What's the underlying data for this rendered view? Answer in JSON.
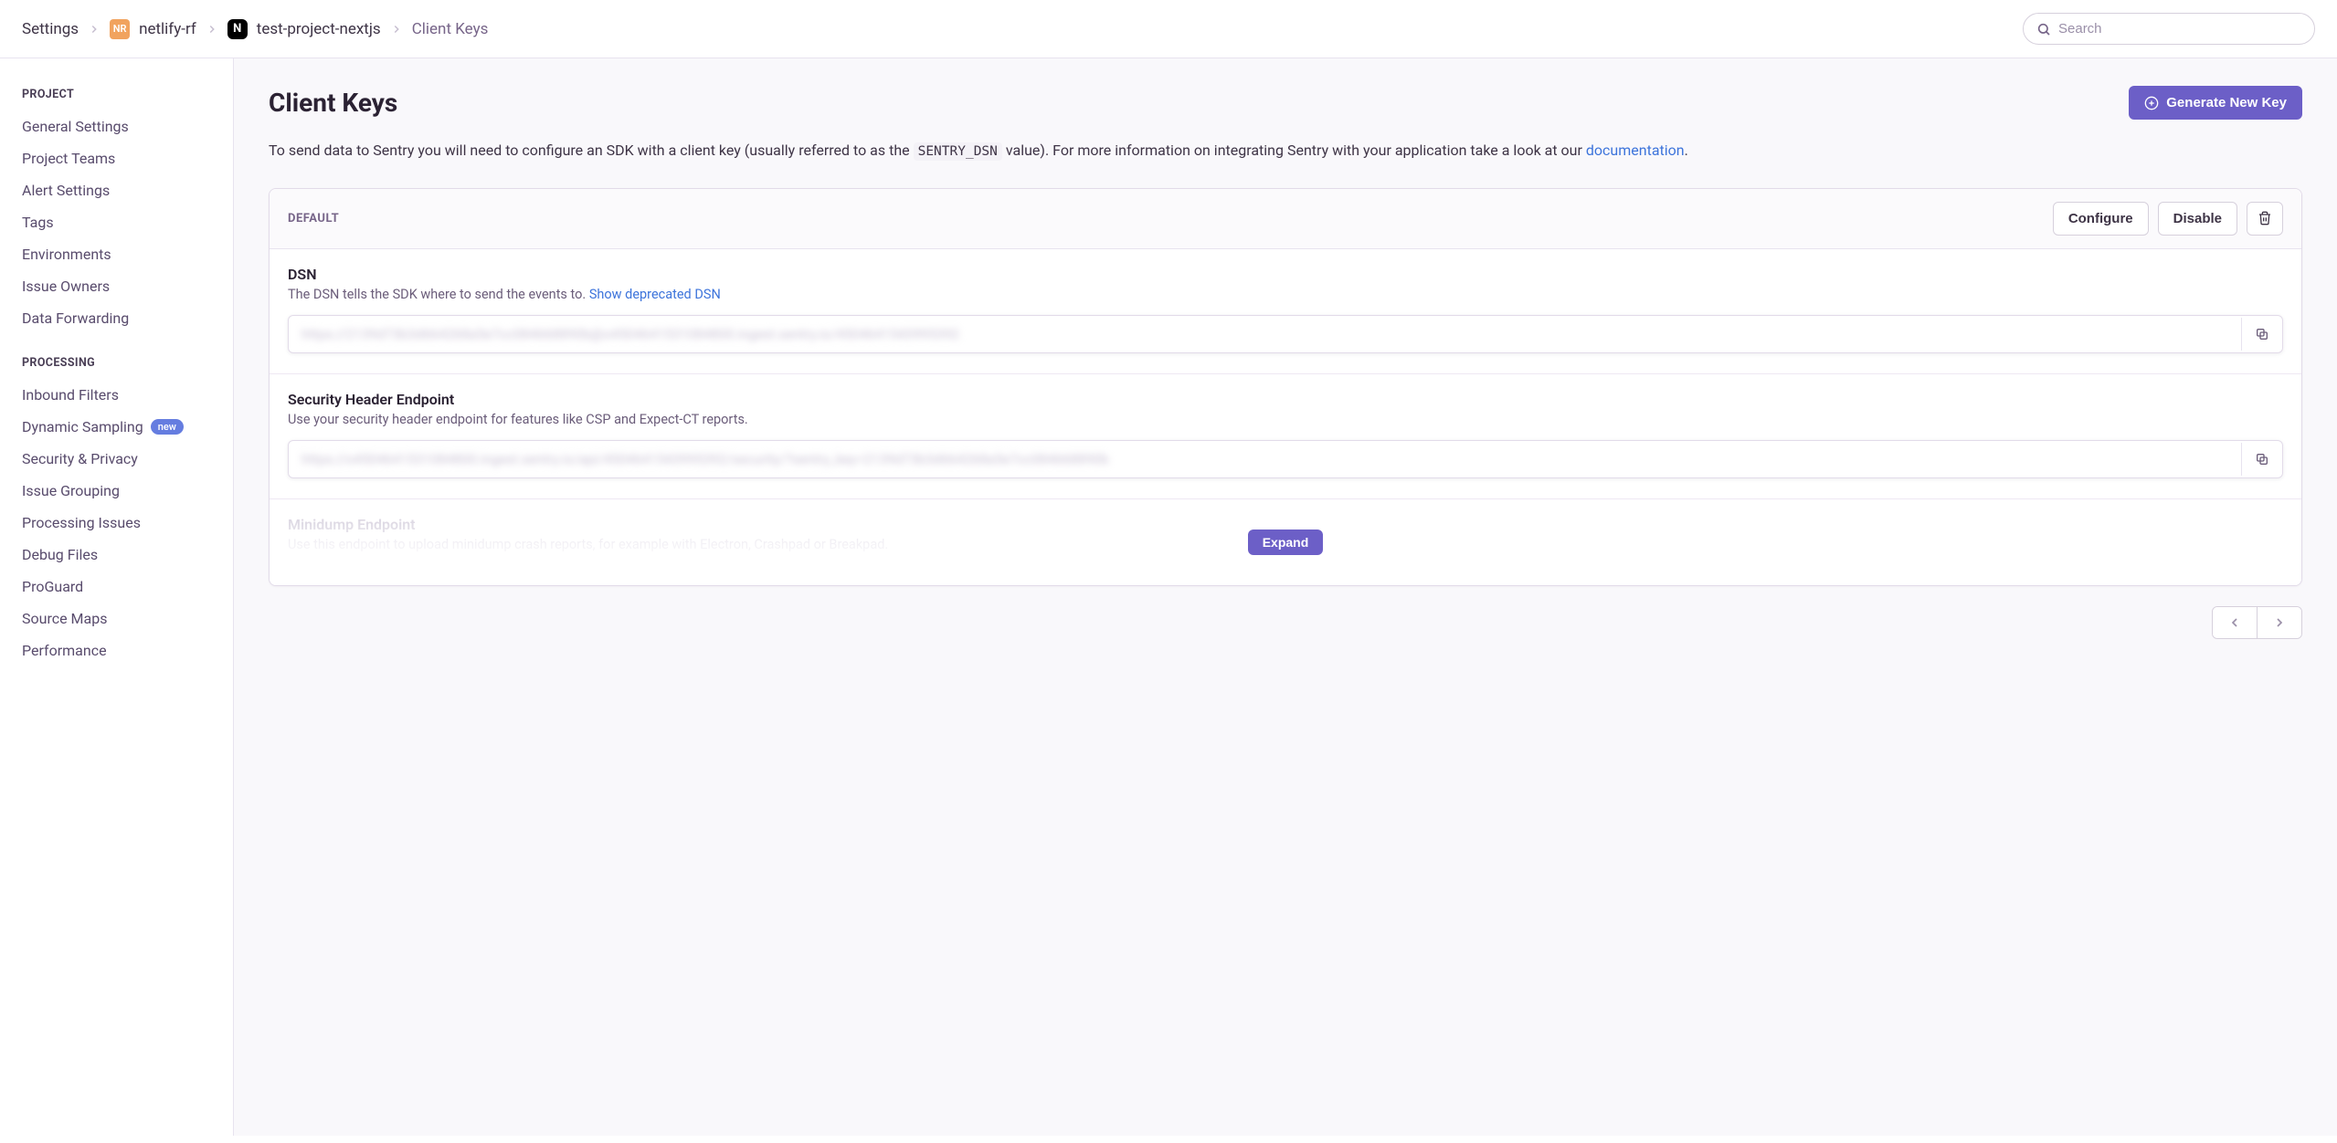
{
  "breadcrumbs": {
    "root": "Settings",
    "org_initials": "NR",
    "org": "netlify-rf",
    "proj_icon": "N",
    "project": "test-project-nextjs",
    "current": "Client Keys"
  },
  "search": {
    "placeholder": "Search"
  },
  "sidebar": {
    "section_project": "PROJECT",
    "project_items": [
      "General Settings",
      "Project Teams",
      "Alert Settings",
      "Tags",
      "Environments",
      "Issue Owners",
      "Data Forwarding"
    ],
    "section_processing": "PROCESSING",
    "processing_items": [
      {
        "label": "Inbound Filters"
      },
      {
        "label": "Dynamic Sampling",
        "badge": "new"
      },
      {
        "label": "Security & Privacy"
      },
      {
        "label": "Issue Grouping"
      },
      {
        "label": "Processing Issues"
      },
      {
        "label": "Debug Files"
      },
      {
        "label": "ProGuard"
      },
      {
        "label": "Source Maps"
      },
      {
        "label": "Performance"
      }
    ]
  },
  "page": {
    "title": "Client Keys",
    "generate_button": "Generate New Key",
    "desc_pre": "To send data to Sentry you will need to configure an SDK with a client key (usually referred to as the ",
    "desc_code": "SENTRY_DSN",
    "desc_mid": " value). For more information on integrating Sentry with your application take a look at our ",
    "desc_link": "documentation",
    "desc_post": "."
  },
  "key_panel": {
    "name": "DEFAULT",
    "configure": "Configure",
    "disable": "Disable",
    "dsn": {
      "title": "DSN",
      "desc": "The DSN tells the SDK where to send the events to. ",
      "link": "Show deprecated DSN",
      "value": "https://2139d73b3d664268a5e7cc084668890b@o4504641531084800.ingest.sentry.io/4504641543995392"
    },
    "security": {
      "title": "Security Header Endpoint",
      "desc": "Use your security header endpoint for features like CSP and Expect-CT reports.",
      "value": "https://o4504641531084800.ingest.sentry.io/api/4504641543995392/security/?sentry_key=2139d73b3d664268a5e7cc084668890b"
    },
    "minidump": {
      "title": "Minidump Endpoint",
      "desc": "Use this endpoint to upload minidump crash reports, for example with Electron, Crashpad or Breakpad."
    },
    "expand": "Expand"
  }
}
